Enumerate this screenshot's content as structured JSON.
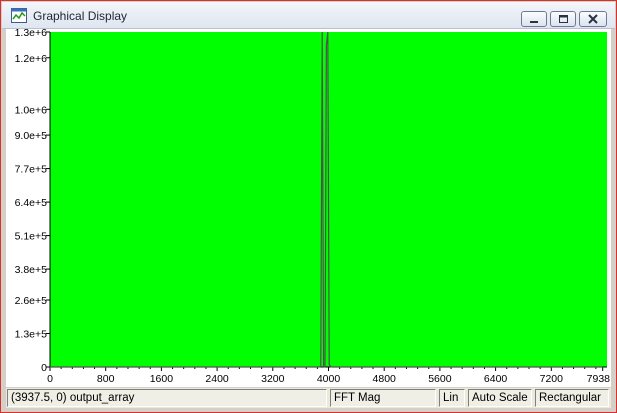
{
  "window": {
    "title": "Graphical Display",
    "icon": "graph-window-icon",
    "buttons": {
      "minimize_icon": "minimize-icon",
      "maximize_icon": "maximize-icon",
      "close_icon": "close-icon"
    }
  },
  "plot": {
    "background_color": "#00ff00",
    "trace_color": "#505050",
    "chart_data": {
      "type": "line",
      "xlim": [
        0,
        8000
      ],
      "ylim": [
        0,
        1300000
      ],
      "x_ticks": [
        0,
        800,
        1600,
        2400,
        3200,
        4000,
        4800,
        5600,
        6400,
        7200,
        7938
      ],
      "x_tick_labels": [
        "0",
        "800",
        "1600",
        "2400",
        "3200",
        "4000",
        "4800",
        "5600",
        "6400",
        "7200",
        "7938"
      ],
      "y_ticks": [
        0,
        130000,
        260000,
        380000,
        510000,
        640000,
        770000,
        900000,
        1000000,
        1200000,
        1300000
      ],
      "y_tick_labels": [
        "0",
        "1.3e+5",
        "2.6e+5",
        "3.8e+5",
        "5.1e+5",
        "6.4e+5",
        "7.7e+5",
        "9.0e+5",
        "1.0e+6",
        "1.2e+6",
        "1.3e+6"
      ],
      "series": [
        {
          "x": [
            0,
            3850,
            3870,
            3890,
            3910,
            3930,
            3950,
            3970,
            3990,
            4010,
            4030,
            4060,
            7938
          ],
          "y": [
            0,
            0,
            500,
            2000,
            1300000,
            2000,
            500,
            1250000,
            1300000,
            10000,
            1000,
            0,
            0
          ]
        }
      ]
    }
  },
  "status": {
    "cursor": "(3937.5, 0)  output_array",
    "display_type": "FFT Mag",
    "scale": "Lin",
    "scale_mode": "Auto Scale",
    "window_type": "Rectangular"
  }
}
